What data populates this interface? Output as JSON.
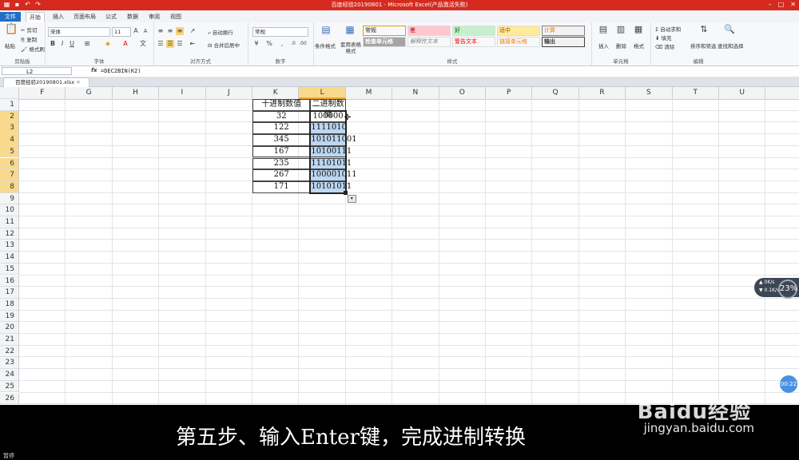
{
  "window": {
    "title": "百度经验20190801 - Microsoft Excel(产品激活失败)",
    "accent": "#d62a1f"
  },
  "tabs": [
    "文件",
    "开始",
    "插入",
    "页面布局",
    "公式",
    "数据",
    "审阅",
    "视图"
  ],
  "ribbon": {
    "clipboard": {
      "label": "剪贴板",
      "paste": "粘贴",
      "cut": "剪切",
      "copy": "复制",
      "format_painter": "格式刷"
    },
    "font": {
      "label": "字体",
      "name": "宋体",
      "size": "11"
    },
    "alignment": {
      "label": "对齐方式",
      "wrap": "自动换行",
      "merge": "合并后居中"
    },
    "number": {
      "label": "数字",
      "format": "常规"
    },
    "styles": {
      "label": "样式",
      "conditional": "条件格式",
      "table": "套用表格格式",
      "cells": [
        {
          "text": "常规",
          "bg": "#ffffff",
          "fg": "#000000"
        },
        {
          "text": "差",
          "bg": "#ffc7ce",
          "fg": "#9c0006"
        },
        {
          "text": "好",
          "bg": "#c6efce",
          "fg": "#006100"
        },
        {
          "text": "适中",
          "bg": "#ffeb9c",
          "fg": "#9c5700"
        },
        {
          "text": "计算",
          "bg": "#f2f2f2",
          "fg": "#fa7d00"
        },
        {
          "text": "检查单元格",
          "bg": "#a5a5a5",
          "fg": "#ffffff"
        },
        {
          "text": "解释性文本",
          "bg": "#ffffff",
          "fg": "#7f7f7f"
        },
        {
          "text": "警告文本",
          "bg": "#ffffff",
          "fg": "#ff0000"
        },
        {
          "text": "链接单元格",
          "bg": "#ffffff",
          "fg": "#fa7d00"
        },
        {
          "text": "输出",
          "bg": "#f2f2f2",
          "fg": "#3f3f3f"
        }
      ]
    },
    "cells_group": {
      "label": "单元格",
      "insert": "插入",
      "delete": "删除",
      "format": "格式"
    },
    "editing": {
      "label": "编辑",
      "autosum": "自动求和",
      "fill": "填充",
      "clear": "清除",
      "sort": "排序和筛选",
      "find": "查找和选择"
    }
  },
  "formula_bar": {
    "name_box": "L2",
    "fx": "fx",
    "formula": "=DEC2BIN(K2)"
  },
  "workbook_tab": "百度经验20190801.xlsx",
  "columns": [
    "F",
    "G",
    "H",
    "I",
    "J",
    "K",
    "L",
    "M",
    "N",
    "O",
    "P",
    "Q",
    "R",
    "S",
    "T",
    "U"
  ],
  "selected_column": "L",
  "rows": [
    "1",
    "2",
    "3",
    "4",
    "5",
    "6",
    "7",
    "8",
    "9",
    "10",
    "11",
    "12",
    "13",
    "14",
    "15",
    "16",
    "17",
    "18",
    "19",
    "20",
    "21",
    "22",
    "23",
    "24",
    "25",
    "26"
  ],
  "table": {
    "headers": [
      "十进制数值",
      "二进制数值"
    ],
    "decimal": [
      "32",
      "122",
      "345",
      "167",
      "235",
      "267",
      "171"
    ],
    "binary": [
      "100000",
      "1111010",
      "101011001",
      "10100111",
      "11101011",
      "100001011",
      "10101011"
    ]
  },
  "overlay": {
    "caption": "第五步、输入Enter键，完成进制转换",
    "watermark_logo": "Baidu经验",
    "watermark_url": "jingyan.baidu.com",
    "speed_pct": "23%",
    "speed_up": "0K/s",
    "speed_down": "0.1K/s",
    "timer": "00:22",
    "pause": "暂停"
  }
}
